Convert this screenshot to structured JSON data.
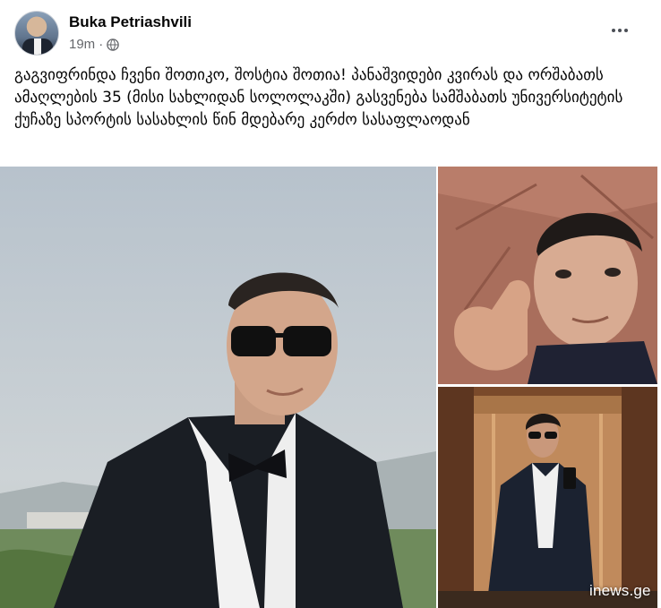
{
  "post": {
    "author": "Buka Petriashvili",
    "time": "19m",
    "privacy_icon": "globe-icon",
    "more_icon": "more-options-icon",
    "text": "გაგვიფრინდა ჩვენი შოთიკო, შოსტია შოთია! პანაშვიდები კვირას და ორშაბათს ამაღლების 35 (მისი სახლიდან სოლოლაკში) გასვენება სამშაბათს უნივერსიტეტის ქუჩაზე სპორტის სასახლის წინ მდებარე კერძო სასაფლაოდან"
  },
  "media": {
    "watermark": "inews.ge"
  },
  "colors": {
    "text_primary": "#050505",
    "text_secondary": "#65676b",
    "background": "#ffffff"
  }
}
